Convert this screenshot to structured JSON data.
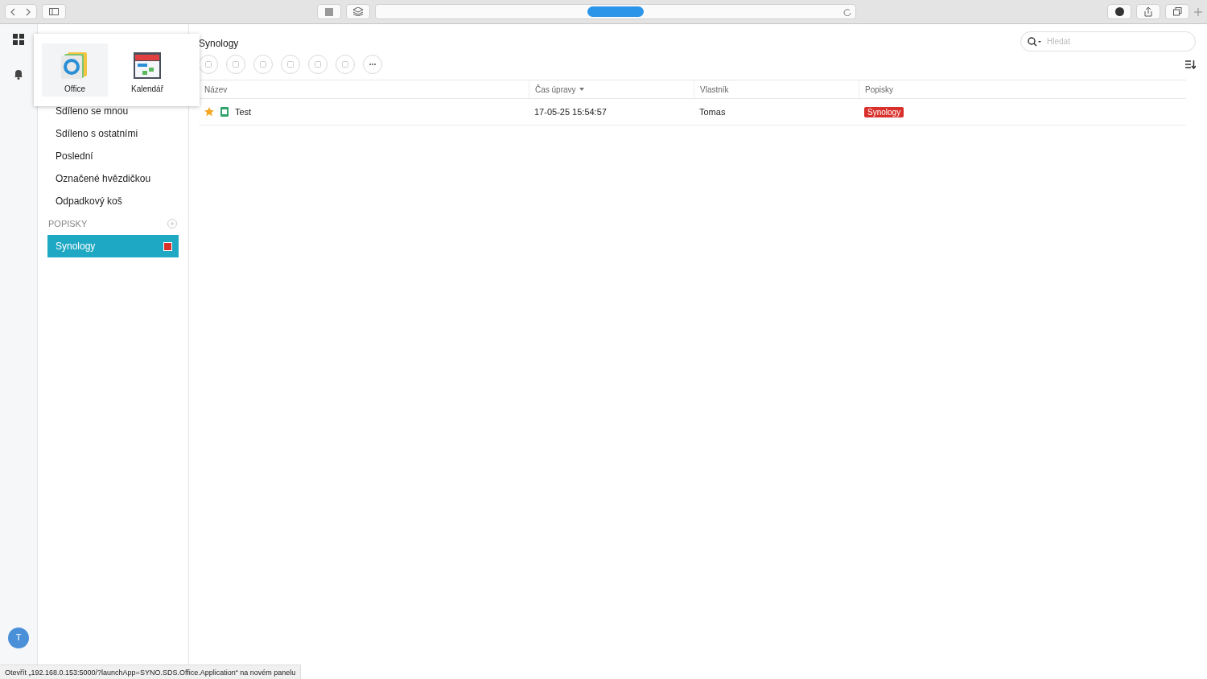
{
  "app_menu": [
    {
      "label": "Office",
      "kind": "office",
      "selected": true
    },
    {
      "label": "Kalendář",
      "kind": "calendar",
      "selected": false
    }
  ],
  "sidebar": {
    "items": [
      {
        "label": "Sdíleno se mnou",
        "selected": false
      },
      {
        "label": "Sdíleno s ostatními",
        "selected": false
      },
      {
        "label": "Poslední",
        "selected": false
      },
      {
        "label": "Označené hvězdičkou",
        "selected": false
      },
      {
        "label": "Odpadkový koš",
        "selected": false
      }
    ],
    "labels_heading": "POPISKY",
    "labels": [
      {
        "label": "Synology",
        "color": "#d9302c",
        "selected": true
      }
    ]
  },
  "avatar": {
    "initial": "T"
  },
  "main": {
    "title": "Synology",
    "search": {
      "placeholder": "Hledat"
    },
    "table": {
      "columns": [
        {
          "label": "Název",
          "sorted": false
        },
        {
          "label": "Čas úpravy",
          "sorted": true
        },
        {
          "label": "Vlastník",
          "sorted": false
        },
        {
          "label": "Popisky",
          "sorted": false
        }
      ],
      "rows": [
        {
          "starred": true,
          "name": "Test",
          "modified": "17-05-25 15:54:57",
          "owner": "Tomas",
          "tags": [
            {
              "label": "Synology",
              "color": "#d9302c"
            }
          ]
        }
      ]
    }
  },
  "status_bar": "Otevřít „192.168.0.153:5000/?launchApp=SYNO.SDS.Office.Application“ na novém panelu"
}
